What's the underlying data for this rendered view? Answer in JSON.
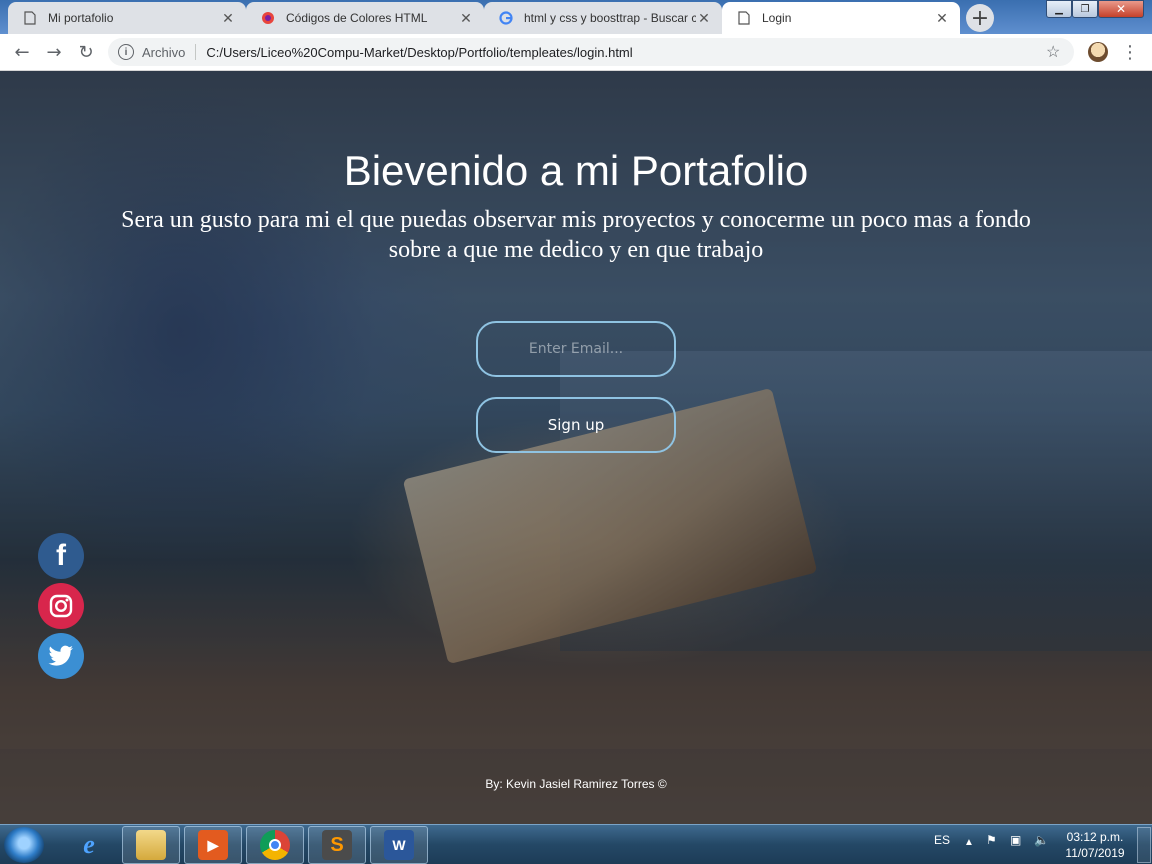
{
  "browser": {
    "tabs": [
      {
        "title": "Mi portafolio",
        "icon": "page-icon"
      },
      {
        "title": "Códigos de Colores HTML",
        "icon": "site-favicon"
      },
      {
        "title": "html y css y boosttrap - Buscar con Google",
        "icon": "google-icon"
      },
      {
        "title": "Login",
        "icon": "page-icon"
      }
    ],
    "active_tab": 3,
    "address": {
      "scheme_label": "Archivo",
      "url": "C:/Users/Liceo%20Compu-Market/Desktop/Portfolio/templeates/login.html"
    }
  },
  "page": {
    "title": "Bievenido a mi Portafolio",
    "subtitle": "Sera un gusto para mi el que puedas observar mis proyectos y conocerme un poco mas a fondo sobre a que me dedico y en que trabajo",
    "email_placeholder": "Enter Email...",
    "signup_label": "Sign up",
    "social": [
      "facebook-icon",
      "instagram-icon",
      "twitter-icon"
    ],
    "footer": "By: Kevin Jasiel Ramirez Torres ©"
  },
  "taskbar": {
    "language": "ES",
    "time": "03:12 p.m.",
    "date": "11/07/2019",
    "apps": [
      "internet-explorer-icon",
      "file-explorer-icon",
      "media-player-icon",
      "chrome-icon",
      "sublime-text-icon",
      "word-icon"
    ]
  },
  "colors": {
    "accent_border": "#8fc3e2",
    "facebook": "#2f5b8f",
    "instagram": "#d8264c",
    "twitter": "#3b8fd3"
  }
}
